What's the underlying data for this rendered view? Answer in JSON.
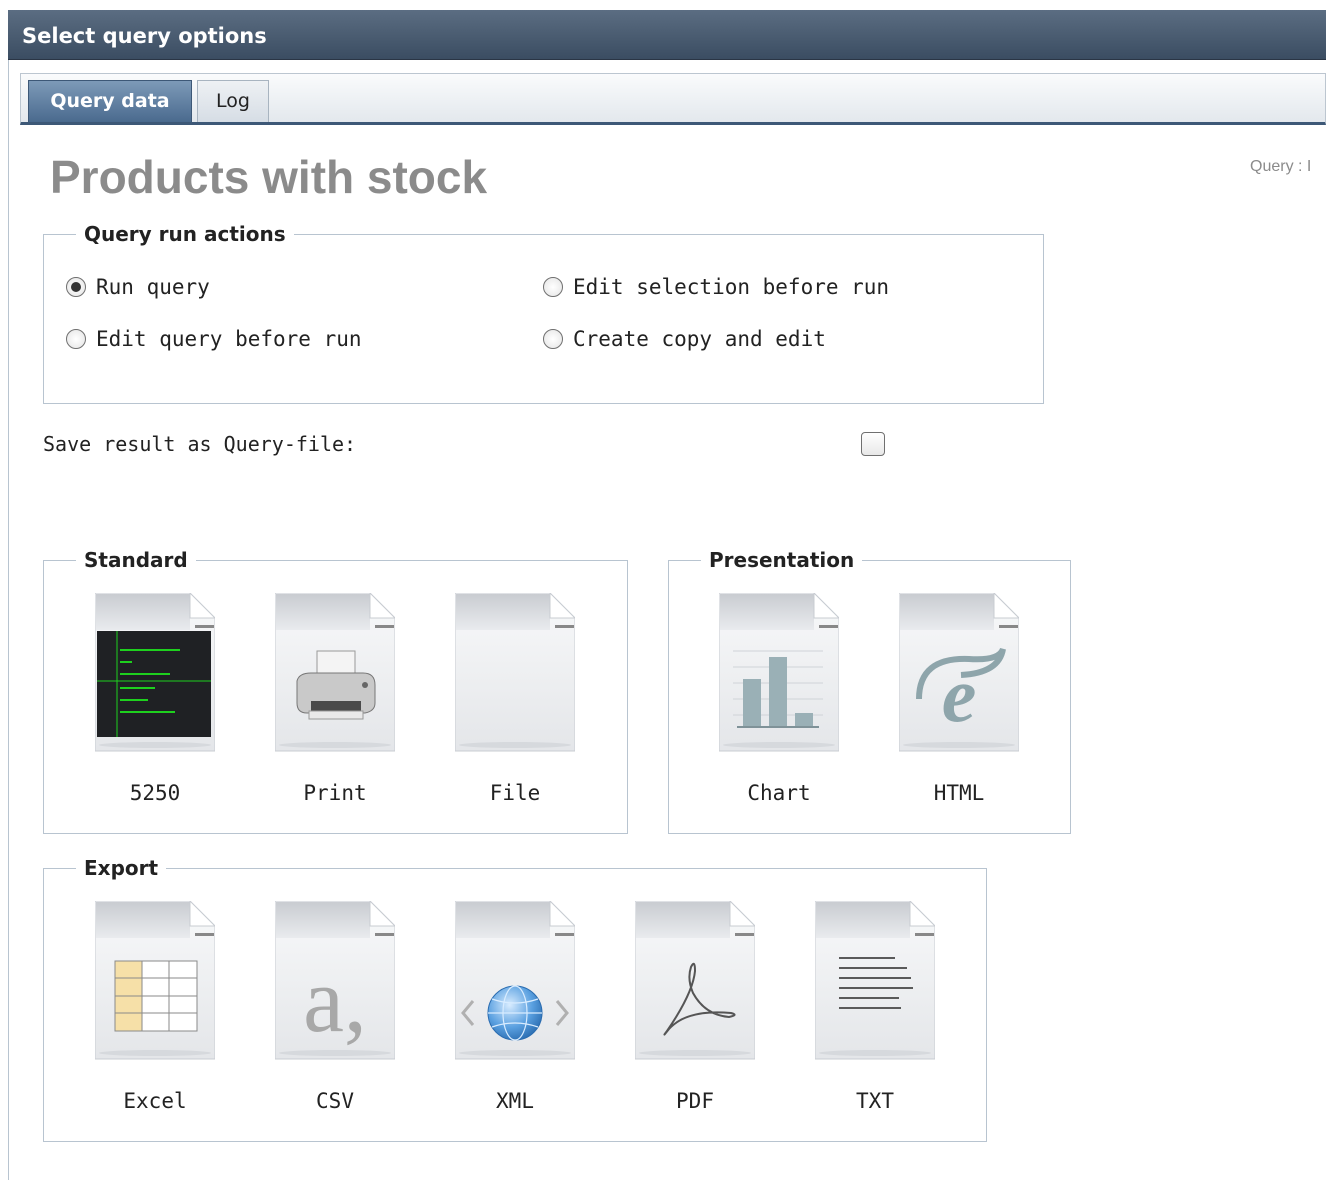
{
  "window": {
    "title": "Select query options"
  },
  "tabs": [
    {
      "label": "Query data"
    },
    {
      "label": "Log"
    }
  ],
  "page": {
    "title": "Products with stock",
    "query_info": "Query : I"
  },
  "run_actions": {
    "legend": "Query run actions",
    "selected": "Run query",
    "options": [
      {
        "label": "Run query",
        "checked": true
      },
      {
        "label": "Edit selection before run",
        "checked": false
      },
      {
        "label": "Edit query before run",
        "checked": false
      },
      {
        "label": "Create copy and edit",
        "checked": false
      }
    ]
  },
  "save_result": {
    "label": "Save result as Query-file:",
    "checked": false
  },
  "standard": {
    "legend": "Standard",
    "items": [
      {
        "label": "5250",
        "icon": "terminal-icon"
      },
      {
        "label": "Print",
        "icon": "printer-icon"
      },
      {
        "label": "File",
        "icon": "file-icon"
      }
    ]
  },
  "presentation": {
    "legend": "Presentation",
    "items": [
      {
        "label": "Chart",
        "icon": "chart-icon"
      },
      {
        "label": "HTML",
        "icon": "ie-icon"
      }
    ]
  },
  "export": {
    "legend": "Export",
    "items": [
      {
        "label": "Excel",
        "icon": "excel-grid-icon"
      },
      {
        "label": "CSV",
        "icon": "csv-icon"
      },
      {
        "label": "XML",
        "icon": "xml-globe-icon"
      },
      {
        "label": "PDF",
        "icon": "pdf-icon"
      },
      {
        "label": "TXT",
        "icon": "txt-icon"
      }
    ]
  },
  "colors": {
    "title_bar": "#3b4d62",
    "tab_active": "#4a6a8e",
    "title_text": "#8b8b8b",
    "border": "#b8c4d0"
  }
}
